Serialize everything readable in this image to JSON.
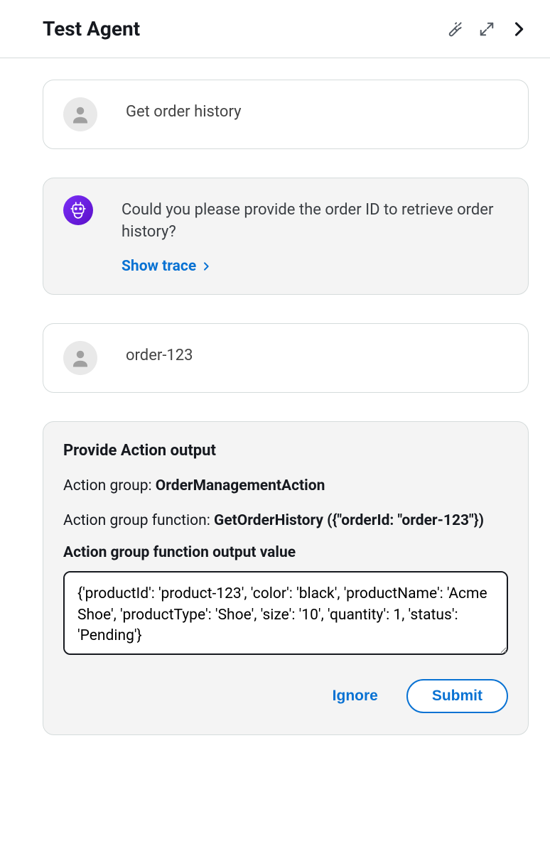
{
  "header": {
    "title": "Test Agent"
  },
  "messages": {
    "user1": "Get order history",
    "agent1": "Could you please provide the order ID to retrieve order history?",
    "show_trace": "Show trace",
    "user2": "order-123"
  },
  "action": {
    "title": "Provide Action output",
    "group_label": "Action group: ",
    "group_value": "OrderManagementAction",
    "func_label": "Action group function: ",
    "func_value": "GetOrderHistory ({\"orderId: \"order-123\"})",
    "output_label": "Action group function output value",
    "output_value": "{'productId': 'product-123', 'color': 'black', 'productName': 'Acme Shoe', 'productType': 'Shoe', 'size': '10', 'quantity': 1, 'status': 'Pending'}",
    "ignore": "Ignore",
    "submit": "Submit"
  }
}
